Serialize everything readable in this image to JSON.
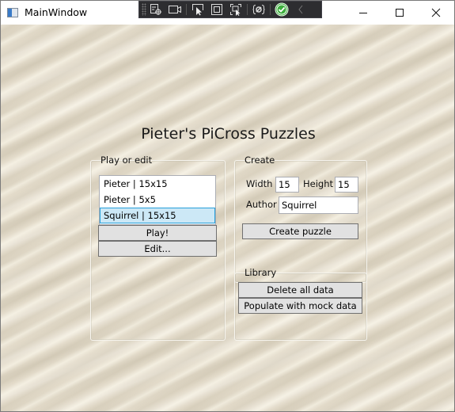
{
  "window": {
    "title": "MainWindow",
    "controls": {
      "minimize": "minimize-icon",
      "maximize": "maximize-icon",
      "close": "close-icon"
    }
  },
  "debug_toolbar": {
    "items": [
      "select-element-icon",
      "record-icon",
      "pointer-select-icon",
      "layout-adorner-icon",
      "track-focus-icon",
      "binding-failures-icon",
      "check-circle-icon",
      "collapse-icon"
    ]
  },
  "colors": {
    "background": "#e4dccb",
    "selection_fill": "#cce8f6",
    "selection_border": "#26a0da",
    "button_fill": "#e1e1e1",
    "check_green": "#3dae3d"
  },
  "heading": "Pieter's PiCross Puzzles",
  "play_or_edit": {
    "label": "Play or edit",
    "puzzles": [
      {
        "text": "Pieter | 15x15",
        "selected": false
      },
      {
        "text": "Pieter | 5x5",
        "selected": false
      },
      {
        "text": "Squirrel | 15x15",
        "selected": true
      }
    ],
    "play_label": "Play!",
    "edit_label": "Edit..."
  },
  "create": {
    "label": "Create",
    "width_label": "Width",
    "width_value": "15",
    "height_label": "Height",
    "height_value": "15",
    "author_label": "Author",
    "author_value": "Squirrel",
    "create_label": "Create puzzle"
  },
  "library": {
    "label": "Library",
    "delete_label": "Delete all data",
    "populate_label": "Populate with mock data"
  }
}
